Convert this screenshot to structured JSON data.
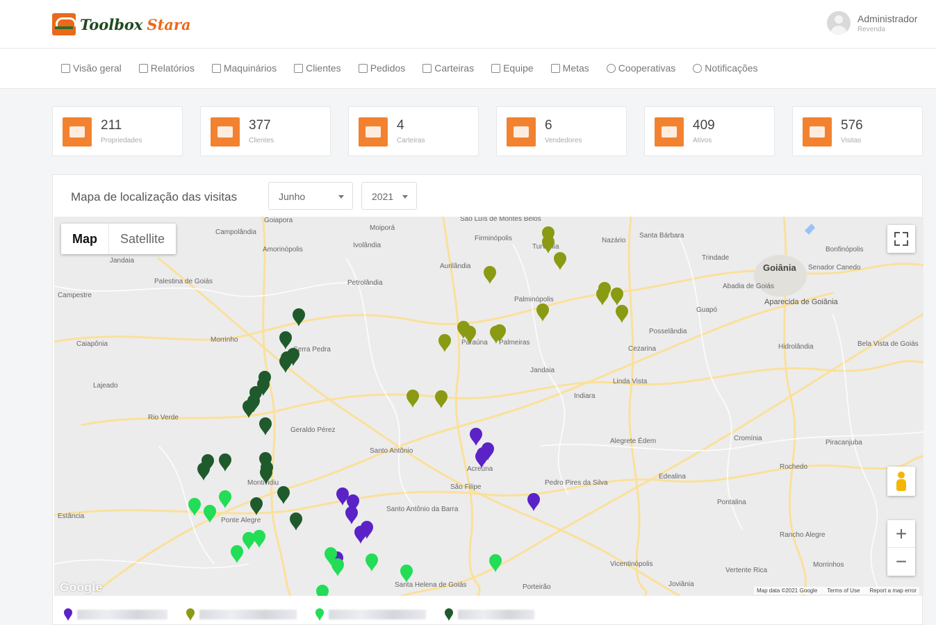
{
  "header": {
    "logo_brand": "Toolbox",
    "logo_suffix": "Stara",
    "user_name": "Administrador",
    "user_role": "Revenda"
  },
  "nav": [
    {
      "label": "Visão geral",
      "icon": "grid-icon"
    },
    {
      "label": "Relatórios",
      "icon": "copy-icon"
    },
    {
      "label": "Maquinários",
      "icon": "truck-icon"
    },
    {
      "label": "Clientes",
      "icon": "users-icon"
    },
    {
      "label": "Pedidos",
      "icon": "grid-icon"
    },
    {
      "label": "Carteiras",
      "icon": "folder-icon"
    },
    {
      "label": "Equipe",
      "icon": "user-add-icon"
    },
    {
      "label": "Metas",
      "icon": "check-square-icon"
    },
    {
      "label": "Cooperativas",
      "icon": "globe-icon"
    },
    {
      "label": "Notificações",
      "icon": "bell-icon"
    }
  ],
  "stats": [
    {
      "value": "211",
      "label": "Propriedades",
      "icon": "barn-icon"
    },
    {
      "value": "377",
      "label": "Clientes",
      "icon": "users-icon"
    },
    {
      "value": "4",
      "label": "Carteiras",
      "icon": "wallet-icon"
    },
    {
      "value": "6",
      "label": "Vendedores",
      "icon": "user-icon"
    },
    {
      "value": "409",
      "label": "Ativos",
      "icon": "tractor-icon"
    },
    {
      "value": "576",
      "label": "Visitas",
      "icon": "map-icon"
    }
  ],
  "map_panel": {
    "title": "Mapa de localização das visitas",
    "month": "Junho",
    "year": "2021",
    "map_type_map": "Map",
    "map_type_satellite": "Satellite",
    "google": "Google",
    "map_data": "Map data ©2021 Google",
    "terms": "Terms of Use",
    "report": "Report a map error",
    "zoom_in": "+",
    "zoom_out": "−"
  },
  "map_labels": [
    "Goiânia",
    "Senador Canedo",
    "Aparecida de Goiânia",
    "Trindade",
    "Santa Bárbara",
    "Nazário",
    "Palminópolis",
    "Aurilândia",
    "Firminópolis",
    "Turvânia",
    "Paraúna",
    "Palmeiras",
    "Jandaia",
    "Indiara",
    "Acreúna",
    "Rio Verde",
    "Santo Antônio",
    "São Filipe",
    "Montividiu",
    "Santa Helena de Goiás",
    "Cezarina",
    "Posselândia",
    "Guapó",
    "Campestre",
    "Hidrolândia",
    "Cromínia",
    "Piracanjuba",
    "Edealina",
    "Pontalina",
    "Rochedo",
    "Rancho Alegre",
    "Morrinhos",
    "Vicentinópolis",
    "Joviânia",
    "Porteirão",
    "Pedro Pires da Silva",
    "Santo Antônio da Barra",
    "Palestina de Goiás",
    "Caiapônia",
    "Lajeado",
    "Campolândia",
    "Amorinópolis",
    "Ivolândia",
    "Moiporá",
    "Petrolândia",
    "Abadia de Goiás",
    "Bela Vista de Goiás",
    "Alegrete Édem",
    "Linda Vista",
    "Geraldo Pérez",
    "Morrinho",
    "Estância",
    "Jandaia",
    "Serra Pedra",
    "Ponte Alegre",
    "Vertente Rica",
    "Goiapora",
    "São Luís de Montes Belos",
    "Bonfinópolis",
    "Rio Verde"
  ],
  "pin_colors": {
    "purple": "#5a22c7",
    "olive": "#8a9a12",
    "lime": "#22dd55",
    "dark_green": "#1f5a2c"
  },
  "legend": [
    {
      "color": "#5a22c7"
    },
    {
      "color": "#8a9a12"
    },
    {
      "color": "#22dd55"
    },
    {
      "color": "#1f5a2c"
    }
  ]
}
